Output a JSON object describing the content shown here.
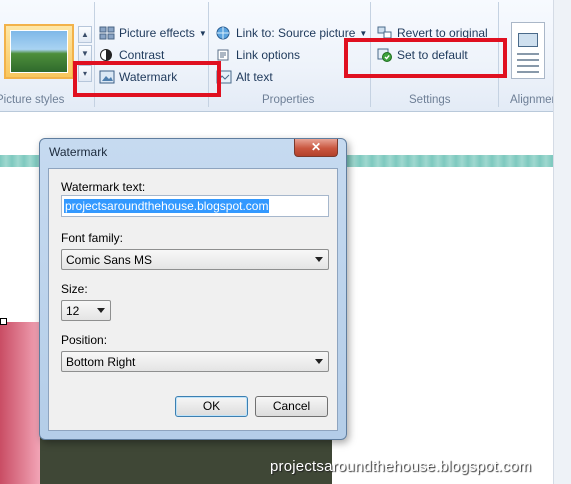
{
  "ribbon": {
    "picture_effects": "Picture effects",
    "contrast": "Contrast",
    "watermark": "Watermark",
    "link_to": "Link to: Source picture",
    "link_options": "Link options",
    "alt_text": "Alt text",
    "revert": "Revert to original",
    "set_default": "Set to default",
    "groups": {
      "picture_styles": "Picture styles",
      "properties": "Properties",
      "settings": "Settings",
      "alignment": "Alignment"
    }
  },
  "dialog": {
    "title": "Watermark",
    "close": "✕",
    "watermark_text_label": "Watermark text:",
    "watermark_text_value": "projectsaroundthehouse.blogspot.com",
    "font_family_label": "Font family:",
    "font_family_value": "Comic Sans MS",
    "size_label": "Size:",
    "size_value": "12",
    "position_label": "Position:",
    "position_value": "Bottom Right",
    "ok": "OK",
    "cancel": "Cancel"
  },
  "image_watermark": "projectsaroundthehouse.blogspot.com",
  "colors": {
    "highlight_box": "#e01020",
    "selection": "#3399ff",
    "dialog_frame": "#b4cde8"
  }
}
